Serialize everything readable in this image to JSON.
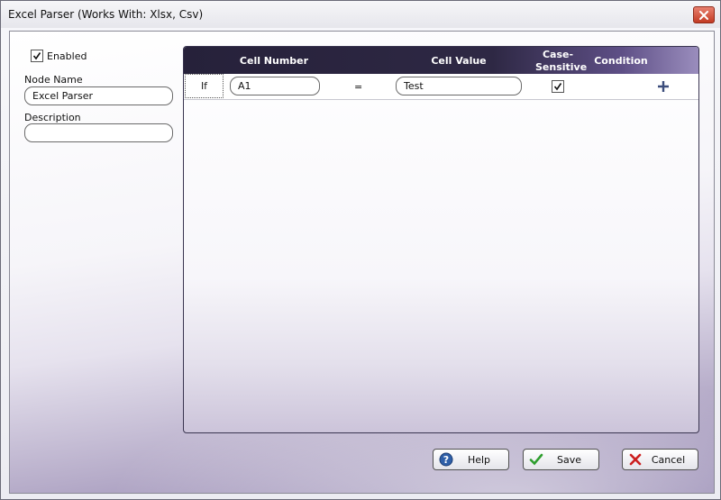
{
  "window": {
    "title": "Excel Parser (Works With: Xlsx, Csv)"
  },
  "left": {
    "enabled_label": "Enabled",
    "enabled_checked": true,
    "node_name_label": "Node Name",
    "node_name_value": "Excel Parser",
    "description_label": "Description",
    "description_value": ""
  },
  "grid": {
    "headers": {
      "cell_number": "Cell Number",
      "cell_value": "Cell Value",
      "case_sensitive": "Case-Sensitive",
      "condition": "Condition"
    },
    "rows": [
      {
        "if_label": "If",
        "cell_number": "A1",
        "operator": "=",
        "cell_value": "Test",
        "case_sensitive": true
      }
    ]
  },
  "buttons": {
    "help": "Help",
    "save": "Save",
    "cancel": "Cancel"
  },
  "colors": {
    "accent": "#5e4f86",
    "header_dark": "#26213a",
    "close_red": "#c33b24",
    "save_green": "#2e9e2e",
    "cancel_red": "#cc1f1f"
  },
  "icons": [
    "close-icon",
    "checkmark-icon",
    "plus-icon",
    "help-icon",
    "save-check-icon",
    "cancel-x-icon"
  ]
}
